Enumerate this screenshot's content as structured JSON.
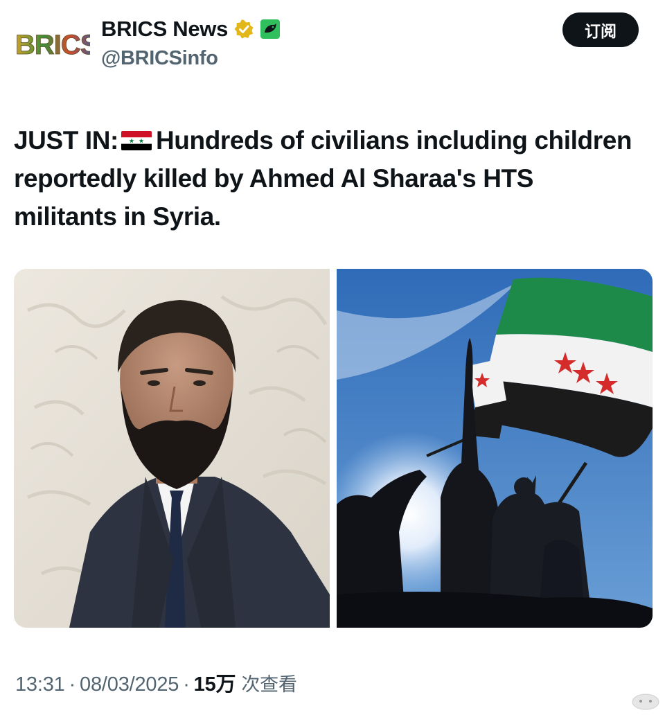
{
  "account": {
    "logo_text": "BRICS",
    "display_name": "BRICS News",
    "handle": "@BRICSinfo",
    "verified_icon": "verified-badge-icon",
    "affiliate_icon": "affiliate-badge-icon"
  },
  "subscribe_label": "订阅",
  "tweet": {
    "prefix": "JUST IN:",
    "flag_icon": "syria-flag-icon",
    "body": "Hundreds of civilians including children reportedly killed by Ahmed Al Sharaa's HTS militants in Syria."
  },
  "media": [
    {
      "name": "man-portrait-image"
    },
    {
      "name": "flag-protest-image"
    }
  ],
  "meta": {
    "time": "13:31",
    "date": "08/03/2025",
    "views_count": "15万",
    "views_label": "次查看"
  },
  "colors": {
    "text": "#0f1419",
    "secondary": "#536471",
    "button_bg": "#0f1419",
    "verified_gold": "#e2b719",
    "affiliate_green": "#2fbf5c"
  }
}
